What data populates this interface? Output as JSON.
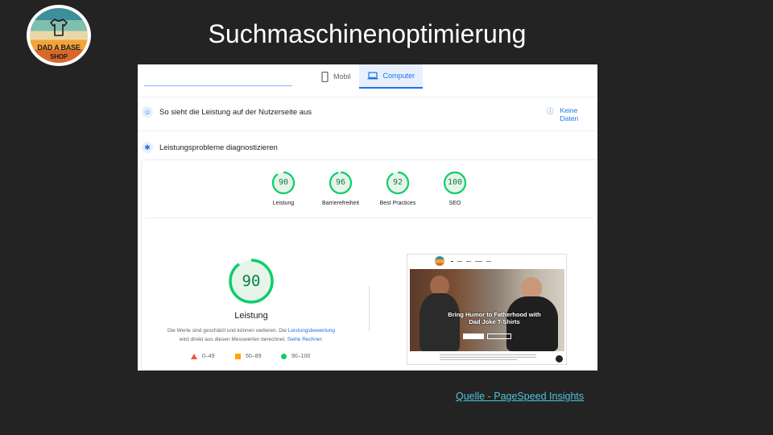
{
  "slide": {
    "title": "Suchmaschinenoptimierung",
    "logo": {
      "line1": "DAD A BASE",
      "line2": "SHOP"
    },
    "source_link": "Quelle - PageSpeed Insights"
  },
  "psi": {
    "tabs": [
      {
        "label": "Mobil",
        "icon": "smartphone-icon",
        "active": false
      },
      {
        "label": "Computer",
        "icon": "laptop-icon",
        "active": true
      }
    ],
    "field_data_row": {
      "label": "So sieht die Leistung auf der Nutzerseite aus",
      "icon": "people-icon"
    },
    "no_data_label": "Keine Daten",
    "diagnose_row": {
      "label": "Leistungsprobleme diagnostizieren",
      "icon": "lighthouse-icon"
    },
    "scores": [
      {
        "label": "Leistung",
        "value": "90",
        "fraction": 0.9
      },
      {
        "label": "Barrierefreiheit",
        "value": "96",
        "fraction": 0.96
      },
      {
        "label": "Best Practices",
        "value": "92",
        "fraction": 0.92
      },
      {
        "label": "SEO",
        "value": "100",
        "fraction": 1.0
      }
    ],
    "main_score": {
      "value": "90",
      "fraction": 0.9,
      "label": "Leistung"
    },
    "note": {
      "text1": "Die Werte sind geschätzt und können variieren. Die ",
      "link1": "Leistungsbewertung",
      "text2": "wird direkt aus diesen Messwerten berechnet. ",
      "link2": "Siehe Rechner."
    },
    "legend": [
      {
        "shape": "triangle",
        "label": "0–49",
        "color": "#ff4e42"
      },
      {
        "shape": "square",
        "label": "50–89",
        "color": "#ffa400"
      },
      {
        "shape": "circle",
        "label": "90–100",
        "color": "#0cce6b"
      }
    ],
    "preview": {
      "headline": "Bring Humor to Fatherhood with Dad Joke T-Shirts"
    }
  }
}
